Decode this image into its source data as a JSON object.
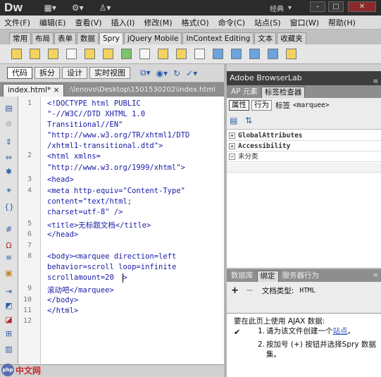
{
  "app": {
    "logo": "Dw",
    "workspace": "经典",
    "window_controls": [
      "–",
      "□",
      "✕"
    ]
  },
  "titlebar_icons": [
    "layout-icon",
    "gear-icon",
    "user-icon"
  ],
  "menu": [
    "文件(F)",
    "编辑(E)",
    "查看(V)",
    "插入(I)",
    "修改(M)",
    "格式(O)",
    "命令(C)",
    "站点(S)",
    "窗口(W)",
    "帮助(H)"
  ],
  "insert_tabs": [
    "常用",
    "布局",
    "表单",
    "数据",
    "Spry",
    "jQuery Mobile",
    "InContext Editing",
    "文本",
    "收藏夹"
  ],
  "insert_active": "Spry",
  "view_buttons": [
    "代码",
    "拆分",
    "设计",
    "实时视图"
  ],
  "document": {
    "tab": "index.html*",
    "path": ":\\lenovo\\Desktop\\1501530202\\index.html"
  },
  "line_numbers": [
    "1",
    "2",
    "3",
    "4",
    "5",
    "6",
    "7",
    "8",
    "9",
    "10",
    "11",
    "12"
  ],
  "code_lines": [
    "<!DOCTYPE html PUBLIC",
    "\"-//W3C//DTD XHTML 1.0",
    "Transitional//EN\"",
    "\"http://www.w3.org/TR/xhtml1/DTD",
    "/xhtml1-transitional.dtd\">",
    "<html xmlns=",
    "\"http://www.w3.org/1999/xhtml\">",
    "<head>",
    "<meta http-equiv=\"Content-Type\"",
    "content=\"text/html;",
    "charset=utf-8\" />",
    "<title>无标题文档</title>",
    "</head>",
    "",
    "<body><marquee direction=left",
    "behavior=scroll loop=infinite",
    "scrollamount=20  >",
    "滚动吧</marquee>",
    "</body>",
    "</html>"
  ],
  "right_panel": {
    "browserlab": "Adobe BrowserLab",
    "tabs": [
      "AP 元素",
      "标签检查器"
    ],
    "active_tab": "标签检查器",
    "attr_buttons": [
      "属性",
      "行为"
    ],
    "tag_label": "标签",
    "tag_name": "<marquee>",
    "categories": [
      "GlobalAttributes",
      "Accessibility",
      "未分类"
    ]
  },
  "bottom_panel": {
    "tabs": [
      "数据库",
      "绑定",
      "服务器行为"
    ],
    "active_tab": "绑定",
    "add_btn": "+",
    "remove_btn": "−",
    "doc_type_label": "文档类型:",
    "doc_type": "HTML",
    "ajax_title": "要在此页上使用 AJAX 数据:",
    "check": "✔",
    "step1_num": "1.",
    "step1_text": "请为该文件创建一个",
    "step1_link": "站点",
    "step1_end": "。",
    "step2_num": "2.",
    "step2_text": "按加号 (+) 按钮并选择Spry 数据集。"
  },
  "watermark": {
    "logo": "php",
    "text": "中文网"
  }
}
